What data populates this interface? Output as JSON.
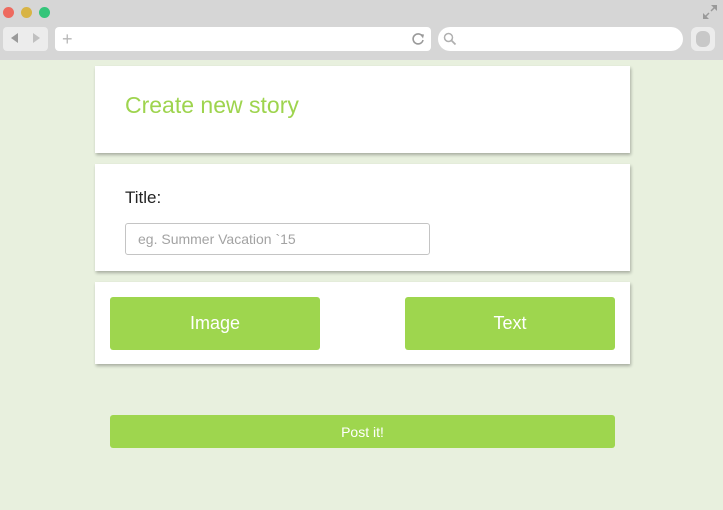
{
  "browser": {
    "window_controls": {
      "close_color": "#ee6a5f",
      "minimize_color": "#d8b445",
      "maximize_color": "#34c57a"
    },
    "icons": {
      "back": "triangle-left",
      "forward": "triangle-right",
      "new_tab": "+",
      "reload": "reload-icon",
      "search": "search-icon",
      "expand": "expand-icon",
      "profile": "profile-icon"
    },
    "new_tab_symbol": "+"
  },
  "story_form": {
    "heading": "Create new story",
    "title_label": "Title:",
    "title_value": "",
    "title_placeholder": "eg. Summer Vacation `15",
    "image_button_label": "Image",
    "text_button_label": "Text",
    "post_button_label": "Post it!"
  },
  "colors": {
    "accent": "#9ed64e",
    "page_background": "#e8f0de",
    "card_background": "#ffffff",
    "chrome_background": "#d6d6d6"
  }
}
